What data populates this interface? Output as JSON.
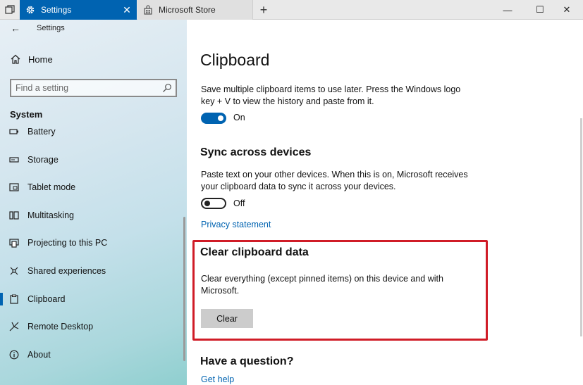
{
  "titlebar": {
    "active_tab": "Settings",
    "inactive_tab": "Microsoft Store",
    "new_tab_glyph": "+",
    "close_glyph": "✕",
    "minimize_glyph": "—",
    "maximize_glyph": "☐",
    "window_close_glyph": "✕"
  },
  "sidebar": {
    "app_title": "Settings",
    "back_glyph": "←",
    "home_label": "Home",
    "search_placeholder": "Find a setting",
    "section_title": "System",
    "items": [
      {
        "label": "Battery",
        "icon": "battery-icon"
      },
      {
        "label": "Storage",
        "icon": "storage-icon"
      },
      {
        "label": "Tablet mode",
        "icon": "tablet-mode-icon"
      },
      {
        "label": "Multitasking",
        "icon": "multitasking-icon"
      },
      {
        "label": "Projecting to this PC",
        "icon": "projecting-icon"
      },
      {
        "label": "Shared experiences",
        "icon": "shared-experiences-icon"
      },
      {
        "label": "Clipboard",
        "icon": "clipboard-icon",
        "selected": true
      },
      {
        "label": "Remote Desktop",
        "icon": "remote-desktop-icon"
      },
      {
        "label": "About",
        "icon": "about-icon"
      }
    ]
  },
  "main": {
    "title": "Clipboard",
    "history": {
      "description": "Save multiple clipboard items to use later. Press the Windows logo key + V to view the history and paste from it.",
      "toggle_state": "On"
    },
    "sync": {
      "title": "Sync across devices",
      "description": "Paste text on your other devices. When this is on, Microsoft receives your clipboard data to sync it across your devices.",
      "toggle_state": "Off",
      "privacy_link": "Privacy statement"
    },
    "clear": {
      "title": "Clear clipboard data",
      "description": "Clear everything (except pinned items) on this device and with Microsoft.",
      "button_label": "Clear"
    },
    "question": {
      "title": "Have a question?",
      "help_link": "Get help"
    }
  },
  "colors": {
    "accent": "#0063b1",
    "highlight_border": "#d01c27"
  }
}
